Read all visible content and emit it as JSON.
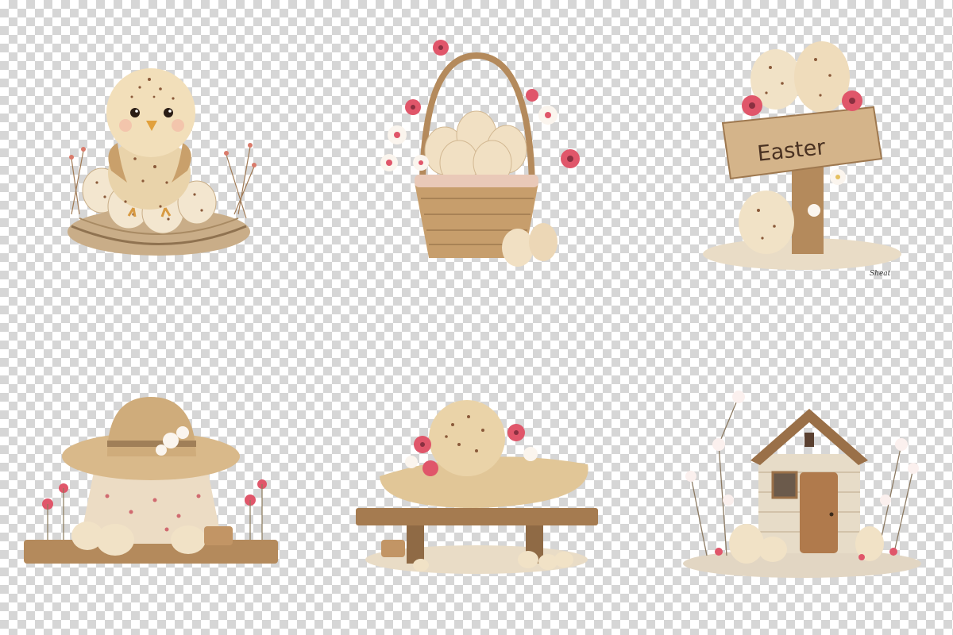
{
  "illustrations": [
    {
      "id": "chick",
      "icon": "chick-in-nest-icon"
    },
    {
      "id": "basket",
      "icon": "egg-basket-icon"
    },
    {
      "id": "sign",
      "icon": "easter-sign-icon",
      "sign_text": "Easter",
      "signature": "Sheat"
    },
    {
      "id": "hat",
      "icon": "straw-hat-icon"
    },
    {
      "id": "bench",
      "icon": "bench-hat-icon"
    },
    {
      "id": "house",
      "icon": "wooden-house-icon"
    }
  ],
  "colors": {
    "checker_light": "#ffffff",
    "checker_dark": "#d6d6d6",
    "egg_cream": "#f1e2c6",
    "speckle_brown": "#8a5a3a",
    "straw": "#d9b98a",
    "wood": "#b48a5c",
    "flower_red": "#e0566a",
    "flower_white": "#fbf5ee"
  }
}
